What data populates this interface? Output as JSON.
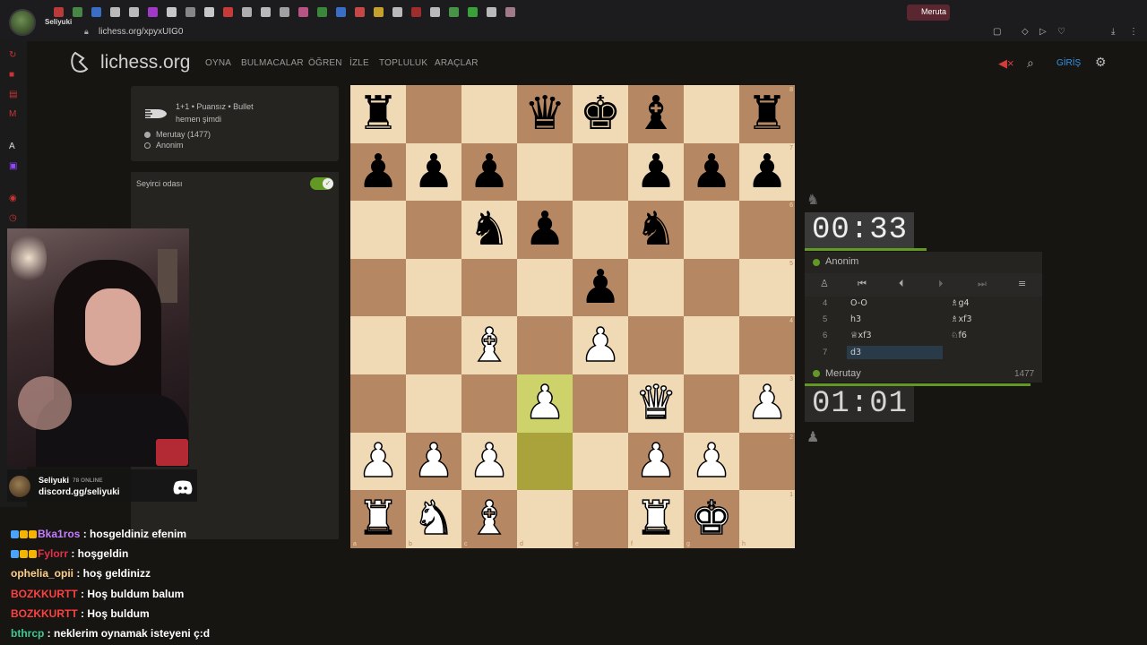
{
  "browser": {
    "url": "lichess.org/xpyxUIG0",
    "active_tab": "Meruta",
    "streamer_tag": "Seliyuki"
  },
  "nav": {
    "logo": "lichess.org",
    "items": [
      "OYNA",
      "BULMACALAR",
      "ÖĞREN",
      "İZLE",
      "TOPLULUK",
      "ARAÇLAR"
    ],
    "login": "GİRİŞ"
  },
  "game": {
    "type": "1+1 • Puansız • Bullet",
    "time": "hemen şimdi",
    "white": "Merutay (1477)",
    "black": "Anonim"
  },
  "spectator": {
    "label": "Seyirci odası",
    "enabled": true
  },
  "stream": {
    "name": "Seliyuki",
    "online": "78 ONLINE",
    "discord": "discord.gg/seliyuki"
  },
  "chat": [
    {
      "user": "Bka1ros",
      "color": "#c77dff",
      "text": " : hosgeldiniz efenim"
    },
    {
      "user": "Fylorr",
      "color": "#e0304a",
      "text": " : hoşgeldin"
    },
    {
      "user": "ophelia_opii",
      "color": "#ffd08a",
      "text": " : hoş geldinizz"
    },
    {
      "user": "BOZKKURTT",
      "color": "#ff4040",
      "text": " : Hoş buldum balum"
    },
    {
      "user": "BOZKKURTT",
      "color": "#ff4040",
      "text": " : Hoş buldum"
    },
    {
      "user": "bthrcp",
      "color": "#40c890",
      "text": " : neklerim oynamak isteyeni ç:d"
    }
  ],
  "board": {
    "ranks": [
      [
        "bR",
        "",
        "",
        "bQ",
        "bK",
        "bB",
        "",
        "bR"
      ],
      [
        "bP",
        "bP",
        "bP",
        "",
        "",
        "bP",
        "bP",
        "bP"
      ],
      [
        "",
        "",
        "bN",
        "bP",
        "",
        "bN",
        "",
        ""
      ],
      [
        "",
        "",
        "",
        "",
        "bP",
        "",
        "",
        ""
      ],
      [
        "",
        "",
        "wB",
        "",
        "wP",
        "",
        "",
        ""
      ],
      [
        "",
        "",
        "",
        "wP",
        "",
        "wQ",
        "",
        "wP"
      ],
      [
        "wP",
        "wP",
        "wP",
        "",
        "",
        "wP",
        "wP",
        ""
      ],
      [
        "wR",
        "wN",
        "wB",
        "",
        "",
        "wR",
        "wK",
        ""
      ]
    ],
    "highlights": [
      "d3",
      "d2"
    ],
    "rank_labels": [
      "8",
      "7",
      "6",
      "5",
      "4",
      "3",
      "2",
      "1"
    ],
    "file_labels": [
      "a",
      "b",
      "c",
      "d",
      "e",
      "f",
      "g",
      "h"
    ]
  },
  "clocks": {
    "top": "00:33",
    "bottom": "01:01"
  },
  "players": {
    "top": "Anonim",
    "bottom": "Merutay",
    "bottom_rating": "1477"
  },
  "moves": [
    {
      "no": "4",
      "w": "O-O",
      "b": "♗g4"
    },
    {
      "no": "5",
      "w": "h3",
      "b": "♗xf3"
    },
    {
      "no": "6",
      "w": "♕xf3",
      "b": "♘f6"
    },
    {
      "no": "7",
      "w": "d3",
      "b": ""
    }
  ],
  "colors": {
    "accent": "#629924",
    "link": "#3692e7",
    "board_light": "#f0d9b5",
    "board_dark": "#b58863"
  }
}
